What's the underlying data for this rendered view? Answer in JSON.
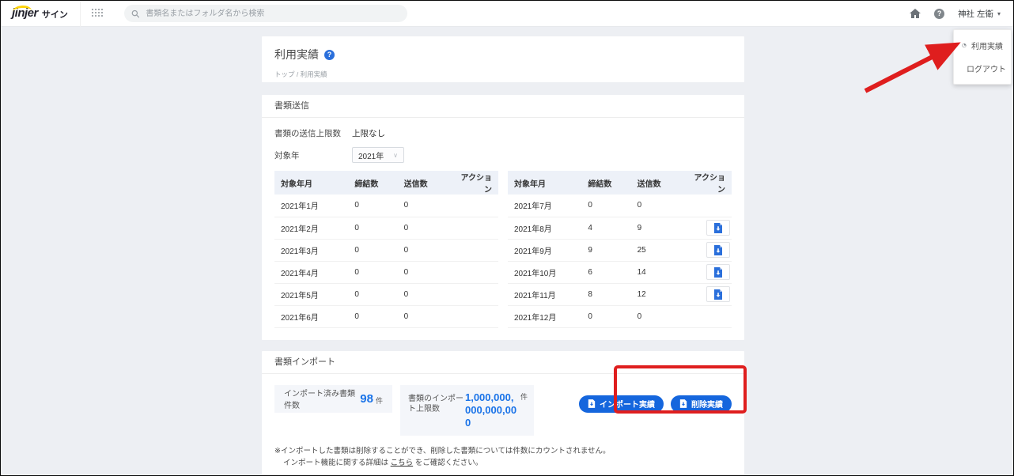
{
  "header": {
    "logo_brand": "jinjer",
    "logo_product": "サイン",
    "search_placeholder": "書類名またはフォルダ名から検索",
    "user_name": "神社 左衛"
  },
  "user_menu": {
    "usage_label": "利用実績",
    "logout_label": "ログアウト"
  },
  "page": {
    "title": "利用実績",
    "help_badge": "?",
    "breadcrumb": "トップ / 利用実績"
  },
  "send_section": {
    "title": "書類送信",
    "limit_label": "書類の送信上限数",
    "limit_value": "上限なし",
    "year_label": "対象年",
    "year_value": "2021年",
    "table_headers": [
      "対象年月",
      "締結数",
      "送信数",
      "アクション"
    ],
    "left_rows": [
      {
        "month": "2021年1月",
        "concluded": "0",
        "sent": "0",
        "has_action": false
      },
      {
        "month": "2021年2月",
        "concluded": "0",
        "sent": "0",
        "has_action": false
      },
      {
        "month": "2021年3月",
        "concluded": "0",
        "sent": "0",
        "has_action": false
      },
      {
        "month": "2021年4月",
        "concluded": "0",
        "sent": "0",
        "has_action": false
      },
      {
        "month": "2021年5月",
        "concluded": "0",
        "sent": "0",
        "has_action": false
      },
      {
        "month": "2021年6月",
        "concluded": "0",
        "sent": "0",
        "has_action": false
      }
    ],
    "right_rows": [
      {
        "month": "2021年7月",
        "concluded": "0",
        "sent": "0",
        "has_action": false
      },
      {
        "month": "2021年8月",
        "concluded": "4",
        "sent": "9",
        "has_action": true
      },
      {
        "month": "2021年9月",
        "concluded": "9",
        "sent": "25",
        "has_action": true
      },
      {
        "month": "2021年10月",
        "concluded": "6",
        "sent": "14",
        "has_action": true
      },
      {
        "month": "2021年11月",
        "concluded": "8",
        "sent": "12",
        "has_action": true
      },
      {
        "month": "2021年12月",
        "concluded": "0",
        "sent": "0",
        "has_action": false
      }
    ]
  },
  "import_section": {
    "title": "書類インポート",
    "imported_label": "インポート済み書類件数",
    "imported_value": "98",
    "imported_unit": "件",
    "limit_label": "書類のインポート上限数",
    "limit_value": "1,000,000,000,000,000",
    "limit_unit": "件",
    "import_button_label": "インポート実績",
    "delete_button_label": "削除実績",
    "note_line1": "※インポートした書類は削除することができ、削除した書類については件数にカウントされません。",
    "note_line2_before": "インポート機能に関する詳細は ",
    "note_link": "こちら",
    "note_line2_after": " をご確認ください。"
  },
  "icons": {
    "user_caret": "▾",
    "select_chevron": "∨",
    "help_glyph": "?"
  },
  "colors": {
    "accent_blue": "#1566dd",
    "value_blue": "#1a73e8",
    "annotation_red": "#df1e1e",
    "table_header_bg": "#edf1f8",
    "page_bg": "#edeff3"
  }
}
